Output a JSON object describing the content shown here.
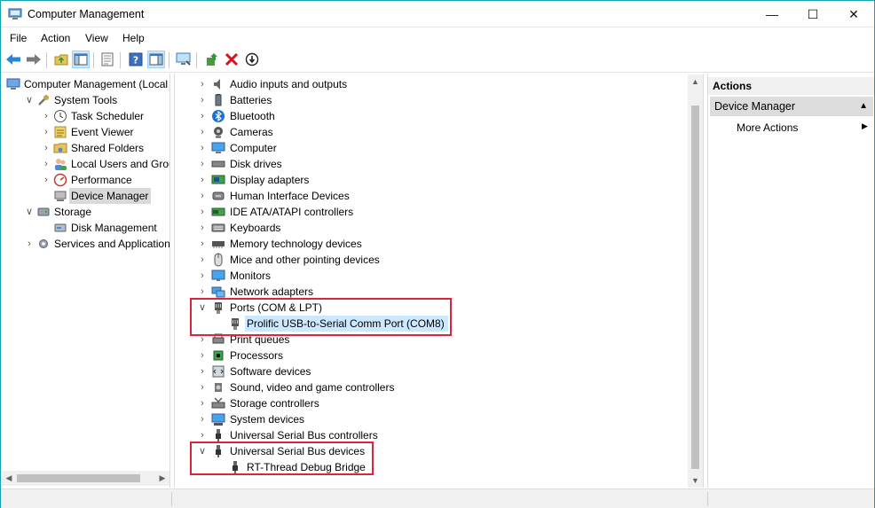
{
  "window": {
    "title": "Computer Management",
    "controls": {
      "minimize": "—",
      "maximize": "☐",
      "close": "✕"
    }
  },
  "menu": [
    "File",
    "Action",
    "View",
    "Help"
  ],
  "left_tree": [
    {
      "label": "Computer Management (Local",
      "icon": "computer-management-icon",
      "depth": 0,
      "expander": "",
      "selected": false
    },
    {
      "label": "System Tools",
      "icon": "system-tools-icon",
      "depth": 1,
      "expander": "v",
      "selected": false
    },
    {
      "label": "Task Scheduler",
      "icon": "task-scheduler-icon",
      "depth": 2,
      "expander": ">",
      "selected": false
    },
    {
      "label": "Event Viewer",
      "icon": "event-viewer-icon",
      "depth": 2,
      "expander": ">",
      "selected": false
    },
    {
      "label": "Shared Folders",
      "icon": "shared-folders-icon",
      "depth": 2,
      "expander": ">",
      "selected": false
    },
    {
      "label": "Local Users and Groups",
      "icon": "local-users-icon",
      "depth": 2,
      "expander": ">",
      "selected": false
    },
    {
      "label": "Performance",
      "icon": "performance-icon",
      "depth": 2,
      "expander": ">",
      "selected": false
    },
    {
      "label": "Device Manager",
      "icon": "device-manager-icon",
      "depth": 2,
      "expander": "",
      "selected": true
    },
    {
      "label": "Storage",
      "icon": "storage-icon",
      "depth": 1,
      "expander": "v",
      "selected": false
    },
    {
      "label": "Disk Management",
      "icon": "disk-management-icon",
      "depth": 2,
      "expander": "",
      "selected": false
    },
    {
      "label": "Services and Applications",
      "icon": "services-icon",
      "depth": 1,
      "expander": ">",
      "selected": false
    }
  ],
  "device_tree": [
    {
      "label": "Audio inputs and outputs",
      "icon": "audio-icon",
      "child": false,
      "expander": ">"
    },
    {
      "label": "Batteries",
      "icon": "battery-icon",
      "child": false,
      "expander": ">"
    },
    {
      "label": "Bluetooth",
      "icon": "bluetooth-icon",
      "child": false,
      "expander": ">"
    },
    {
      "label": "Cameras",
      "icon": "camera-icon",
      "child": false,
      "expander": ">"
    },
    {
      "label": "Computer",
      "icon": "computer-icon",
      "child": false,
      "expander": ">"
    },
    {
      "label": "Disk drives",
      "icon": "disk-drive-icon",
      "child": false,
      "expander": ">"
    },
    {
      "label": "Display adapters",
      "icon": "display-adapter-icon",
      "child": false,
      "expander": ">"
    },
    {
      "label": "Human Interface Devices",
      "icon": "hid-icon",
      "child": false,
      "expander": ">"
    },
    {
      "label": "IDE ATA/ATAPI controllers",
      "icon": "ide-icon",
      "child": false,
      "expander": ">"
    },
    {
      "label": "Keyboards",
      "icon": "keyboard-icon",
      "child": false,
      "expander": ">"
    },
    {
      "label": "Memory technology devices",
      "icon": "memory-icon",
      "child": false,
      "expander": ">"
    },
    {
      "label": "Mice and other pointing devices",
      "icon": "mouse-icon",
      "child": false,
      "expander": ">"
    },
    {
      "label": "Monitors",
      "icon": "monitor-icon",
      "child": false,
      "expander": ">"
    },
    {
      "label": "Network adapters",
      "icon": "network-icon",
      "child": false,
      "expander": ">"
    },
    {
      "label": "Ports (COM & LPT)",
      "icon": "port-icon",
      "child": false,
      "expander": "v"
    },
    {
      "label": "Prolific USB-to-Serial Comm Port (COM8)",
      "icon": "port-icon",
      "child": true,
      "expander": "",
      "selected": true
    },
    {
      "label": "Print queues",
      "icon": "printer-icon",
      "child": false,
      "expander": ">"
    },
    {
      "label": "Processors",
      "icon": "processor-icon",
      "child": false,
      "expander": ">"
    },
    {
      "label": "Software devices",
      "icon": "software-device-icon",
      "child": false,
      "expander": ">"
    },
    {
      "label": "Sound, video and game controllers",
      "icon": "sound-icon",
      "child": false,
      "expander": ">"
    },
    {
      "label": "Storage controllers",
      "icon": "storage-controller-icon",
      "child": false,
      "expander": ">"
    },
    {
      "label": "System devices",
      "icon": "system-device-icon",
      "child": false,
      "expander": ">"
    },
    {
      "label": "Universal Serial Bus controllers",
      "icon": "usb-icon",
      "child": false,
      "expander": ">"
    },
    {
      "label": "Universal Serial Bus devices",
      "icon": "usb-icon",
      "child": false,
      "expander": "v"
    },
    {
      "label": "RT-Thread Debug Bridge",
      "icon": "usb-icon",
      "child": true,
      "expander": ""
    }
  ],
  "actions": {
    "header": "Actions",
    "section": "Device Manager",
    "item": "More Actions"
  },
  "colors": {
    "highlight_box": "#d9263a",
    "window_border": "#17a2b8",
    "selection": "#cce8ff"
  }
}
